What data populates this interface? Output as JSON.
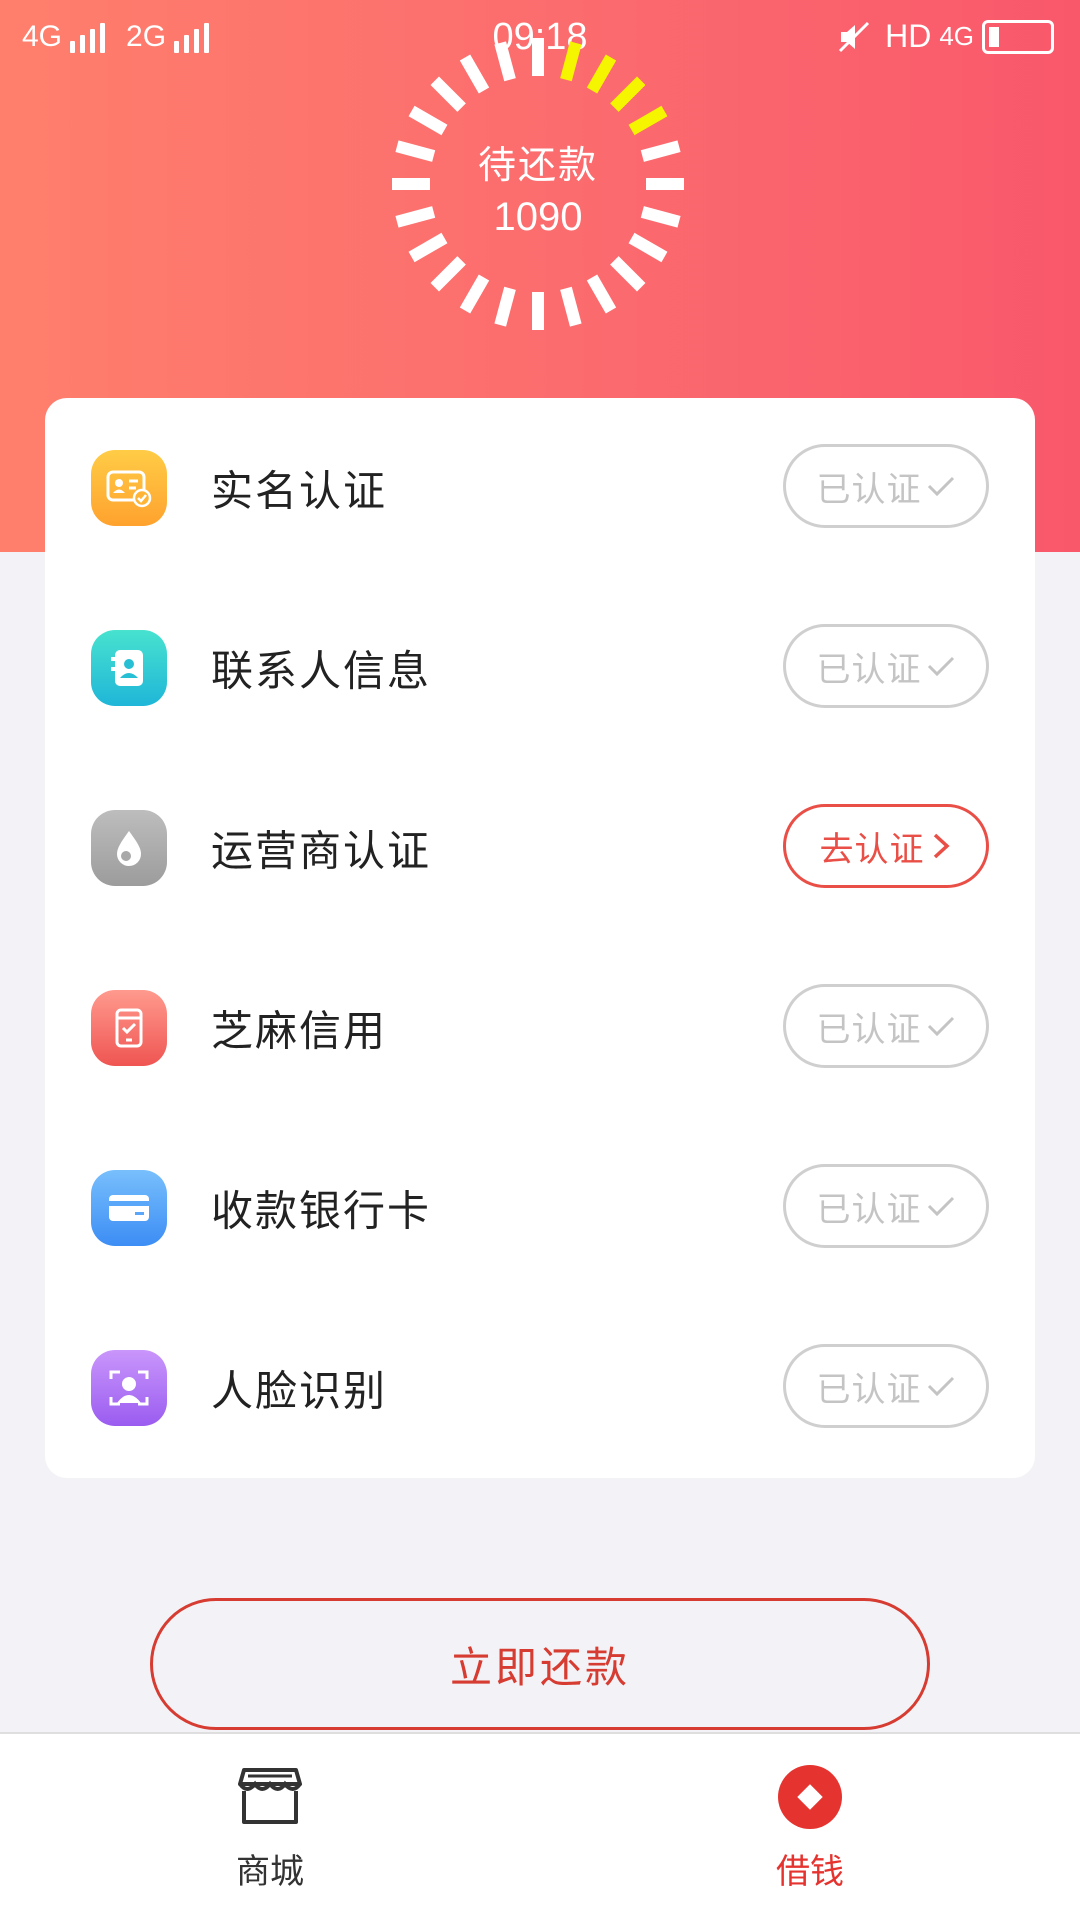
{
  "status_bar": {
    "network_1": "4G",
    "network_2": "2G",
    "time": "09:18",
    "hd": "HD",
    "network_3": "4G"
  },
  "header": {
    "pending_label": "待还款",
    "pending_amount": "1090"
  },
  "verification": {
    "items": [
      {
        "label": "实名认证",
        "icon": "id-card-icon",
        "status": "已认证",
        "state": "verified"
      },
      {
        "label": "联系人信息",
        "icon": "contact-book-icon",
        "status": "已认证",
        "state": "verified"
      },
      {
        "label": "运营商认证",
        "icon": "carrier-drop-icon",
        "status": "去认证",
        "state": "pending"
      },
      {
        "label": "芝麻信用",
        "icon": "credit-phone-icon",
        "status": "已认证",
        "state": "verified"
      },
      {
        "label": "收款银行卡",
        "icon": "bank-card-icon",
        "status": "已认证",
        "state": "verified"
      },
      {
        "label": "人脸识别",
        "icon": "face-scan-icon",
        "status": "已认证",
        "state": "verified"
      }
    ]
  },
  "actions": {
    "repay_label": "立即还款"
  },
  "tabbar": {
    "shop_label": "商城",
    "loan_label": "借钱"
  },
  "colors": {
    "hero_start": "#ff7f6c",
    "hero_end": "#f9586b",
    "accent_red": "#e94f46",
    "spinner_highlight": "#f5f500"
  }
}
